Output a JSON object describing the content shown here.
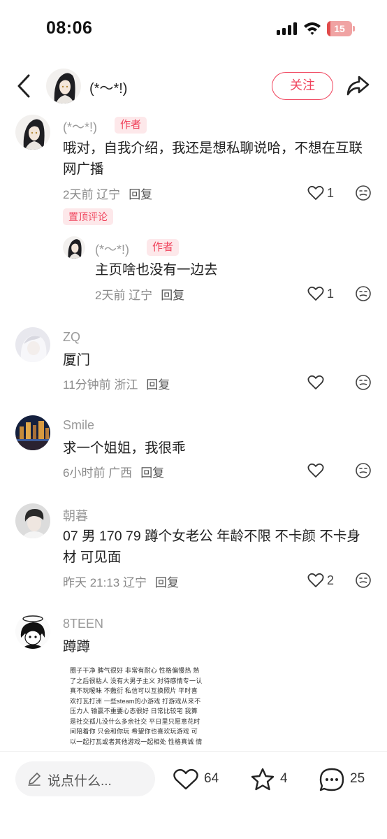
{
  "status_bar": {
    "time": "08:06",
    "battery": "15",
    "battery_level": 0.15
  },
  "header": {
    "username": "(*～*!)",
    "follow_label": "关注"
  },
  "comments": [
    {
      "username": "(*～*!)",
      "author_tag": "作者",
      "text_lines": [
        "哦对，自我介绍，我还是想私聊说哈，不想在互联",
        "网广播"
      ],
      "time_location": "2天前 辽宁",
      "reply_label": "回复",
      "likes": "1",
      "pinned_tag": "置顶评论"
    },
    {
      "username": "(*～*!)",
      "author_tag": "作者",
      "text_lines": [
        "主页啥也没有一边去"
      ],
      "time_location": "2天前 辽宁",
      "reply_label": "回复",
      "likes": "1"
    },
    {
      "username": "ZQ",
      "text_lines": [
        "厦门"
      ],
      "time_location": "11分钟前 浙江",
      "reply_label": "回复",
      "likes": ""
    },
    {
      "username": "Smile",
      "text_lines": [
        "求一个姐姐，我很乖"
      ],
      "time_location": "6小时前 广西",
      "reply_label": "回复",
      "likes": ""
    },
    {
      "username": "朝暮",
      "text_lines": [
        "07 男 170 79 蹲个女老公 年龄不限 不卡颜 不卡身",
        "材 可见面"
      ],
      "time_location": "昨天 21:13 辽宁",
      "reply_label": "回复",
      "likes": "2"
    },
    {
      "username": "8TEEN",
      "text_lines": [
        "蹲蹲"
      ],
      "image_text_lines": [
        "圈子干净 脾气很好 非常有耐心 性格偏慢热 熟",
        "了之后很粘人 没有大男子主义 对待感情专一认",
        "真不玩暧昧 不敷衍 私信可以互换照片 平时喜",
        "欢打瓦打洲 一些steam的小游戏 打游戏从来不",
        "压力人 输赢不重要心态很好 日常比较宅 我算",
        "是社交孤儿没什么多余社交 平日里只愿意花时",
        "间陪着你 只会和你玩 希望你也喜欢玩游戏 可",
        "以一起打瓦或者其他游戏一起相处 性格真诚 情"
      ]
    }
  ],
  "bottom_bar": {
    "input_placeholder": "说点什么...",
    "likes": "64",
    "favorites": "4",
    "comments": "25"
  },
  "colors": {
    "accent": "#f0435c",
    "tag_bg": "#fde8ea",
    "meta_gray": "#8a8a8a"
  }
}
